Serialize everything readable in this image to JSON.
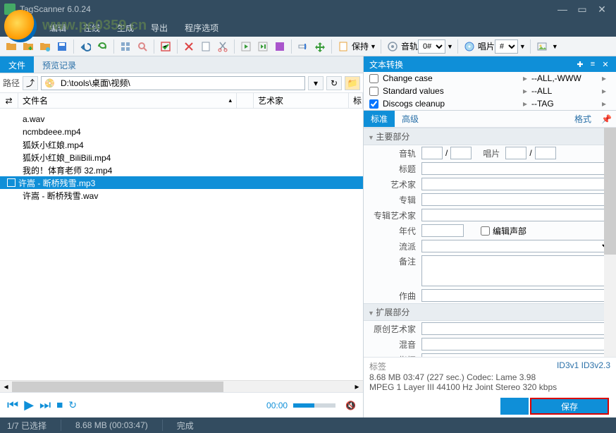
{
  "window": {
    "title": "TagScanner 6.0.24"
  },
  "menu": {
    "edit": "编辑",
    "online": "在线",
    "generate": "生成",
    "export": "导出",
    "options": "程序选项"
  },
  "watermark": "www.pc0359.cn",
  "toolbar": {
    "keep": "保持",
    "track": "音轨",
    "track_val": "0#",
    "album": "唱片",
    "album_val": "#"
  },
  "tabs": {
    "file": "文件",
    "preview": "预览记录"
  },
  "path": {
    "label": "路径",
    "value": "D:\\tools\\桌面\\视频\\"
  },
  "file_header": {
    "shuffle": "⇄",
    "name": "文件名",
    "artist": "艺术家",
    "tag": "标"
  },
  "files": [
    {
      "name": "a.wav",
      "selected": false
    },
    {
      "name": "ncmbdeee.mp4",
      "selected": false
    },
    {
      "name": "狐妖小红娘.mp4",
      "selected": false
    },
    {
      "name": "狐妖小红娘_BiliBili.mp4",
      "selected": false
    },
    {
      "name": "我的！体育老师 32.mp4",
      "selected": false
    },
    {
      "name": "许嵩 - 断桥残雪.mp3",
      "selected": true
    },
    {
      "name": "许嵩 - 断桥残雪.wav",
      "selected": false
    }
  ],
  "player": {
    "time": "00:00"
  },
  "convert": {
    "title": "文本转换",
    "rows": [
      {
        "label": "Change case",
        "val": "--ALL,-WWW",
        "checked": false
      },
      {
        "label": "Standard values",
        "val": "--ALL",
        "checked": false
      },
      {
        "label": "Discogs cleanup",
        "val": "--TAG",
        "checked": true
      }
    ]
  },
  "tagtabs": {
    "std": "标准",
    "adv": "高级",
    "fmt": "格式"
  },
  "form": {
    "section_main": "主要部分",
    "section_ext": "扩展部分",
    "track": "音轨",
    "album_no": "唱片",
    "title": "标题",
    "artist": "艺术家",
    "album": "专辑",
    "album_artist": "专辑艺术家",
    "year": "年代",
    "compilation": "编辑声部",
    "genre": "流派",
    "remark": "备注",
    "composer": "作曲",
    "orig_artist": "原创艺术家",
    "mixer": "混音",
    "conductor": "指挥"
  },
  "taginfo": {
    "tags": "标签",
    "id3v1": "ID3v1",
    "id3v23": "ID3v2.3",
    "line1": "8.68 MB  03:47 (227 sec.)  Codec: Lame 3.98",
    "line2": "MPEG 1 Layer III  44100 Hz  Joint Stereo  320 kbps"
  },
  "save": "保存",
  "status": {
    "sel": "1/7 已选择",
    "size": "8.68 MB (00:03:47)",
    "done": "完成"
  }
}
